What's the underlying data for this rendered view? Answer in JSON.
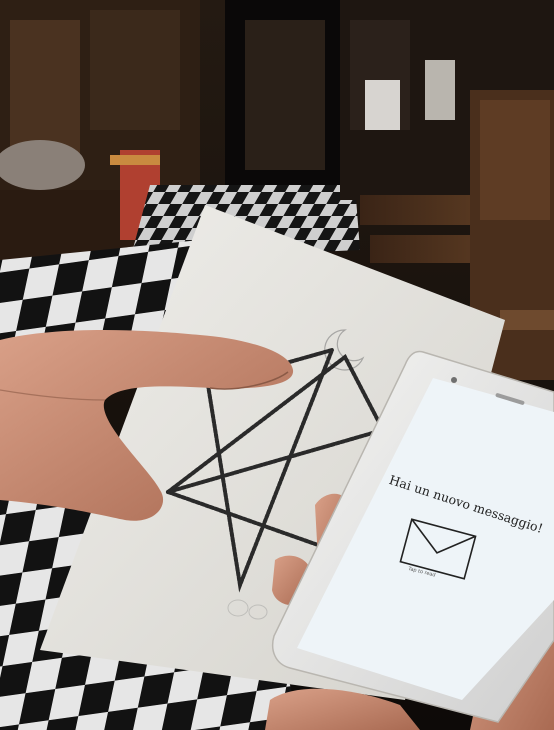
{
  "scene": {
    "description_tags": [
      "church-interior",
      "checkered-floor",
      "paper-with-chain-star",
      "smartphone"
    ]
  },
  "phone": {
    "message": "Hai un nuovo messaggio!",
    "sub_label": "Tap to read"
  },
  "colors": {
    "floor_dark": "#111111",
    "floor_light": "#e8e8e8",
    "paper": "#e9e7e2",
    "screen": "#eef4f8",
    "wood": "#5a3a22",
    "skin": "#c98f74"
  }
}
